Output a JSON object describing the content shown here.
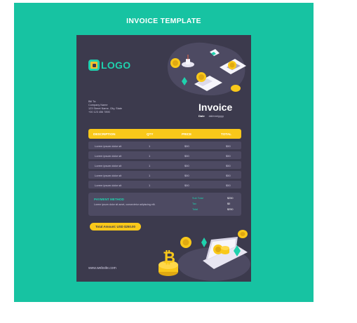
{
  "frame": {
    "title": "INVOICE TEMPLATE",
    "background": "#17c3a2"
  },
  "invoice": {
    "logo_text": "LOGO",
    "sender_lines": [
      "Bill To:",
      "Company Name",
      "123 Street Name, City, State",
      "+00 123 456 7890"
    ],
    "title": "Invoice",
    "date_label": "Date",
    "date_value": "dd/mm/yyyy",
    "table": {
      "headers": [
        "DESCRIPTION",
        "QTY",
        "PRICE",
        "TOTAL"
      ],
      "rows": [
        [
          "Lorem ipsum dolor sit",
          "1",
          "$50",
          "$50"
        ],
        [
          "Lorem ipsum dolor sit",
          "1",
          "$50",
          "$50"
        ],
        [
          "Lorem ipsum dolor sit",
          "1",
          "$50",
          "$50"
        ],
        [
          "Lorem ipsum dolor sit",
          "1",
          "$50",
          "$50"
        ],
        [
          "Lorem ipsum dolor sit",
          "1",
          "$50",
          "$50"
        ]
      ]
    },
    "payment_method": {
      "title": "PAYMENT METHOD",
      "text": "Lorem ipsum dolor sit amet, consectetur adipiscing elit."
    },
    "totals": [
      {
        "label": "Sub Total",
        "value": "$250"
      },
      {
        "label": "Tax",
        "value": "$0"
      },
      {
        "label": "Total",
        "value": "$250"
      }
    ],
    "total_amount": "Total Amount: USD $250.00",
    "website": "www.website.com"
  },
  "colors": {
    "sheet": "#3c3a4d",
    "accent_yellow": "#f9c81a",
    "accent_teal": "#1fd1ad",
    "row": "#4d4a62"
  }
}
